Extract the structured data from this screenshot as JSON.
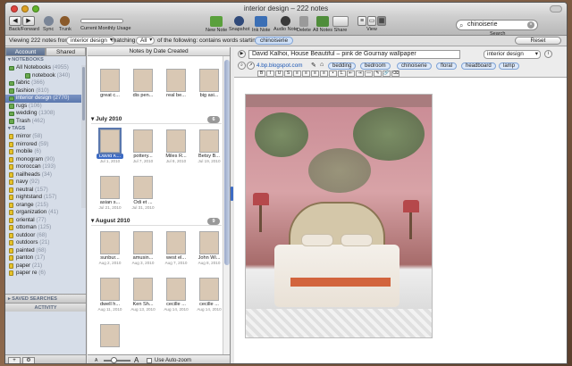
{
  "window": {
    "title": "interior design – 222 notes"
  },
  "toolbar": {
    "back_forward": "Back/Forward",
    "sync": "Sync",
    "trunk": "Trunk",
    "usage": "Current Monthly Usage",
    "new_note": "New Note",
    "snapshot": "Snapshot",
    "ink_note": "Ink Note",
    "audio_note": "Audio Note",
    "delete": "Delete",
    "all_notes": "All Notes",
    "share": "Share",
    "view": "View",
    "search_label": "Search",
    "search_value": "chinoiserie"
  },
  "filter": {
    "viewing": "Viewing 222 notes from",
    "notebook": "interior design",
    "matching": "matching",
    "match_mode": "All",
    "rest": "of the following: contains words starting with",
    "token": "chinoiserie",
    "reset": "Reset"
  },
  "sidebar": {
    "tabs": [
      "Account",
      "Shared"
    ],
    "notebooks_head": "NOTEBOOKS",
    "notebooks": [
      {
        "name": "All Notebooks",
        "count": "(4955)"
      },
      {
        "name": "notebook",
        "count": "(340)"
      },
      {
        "name": "fabric",
        "count": "(366)"
      },
      {
        "name": "fashion",
        "count": "(810)"
      },
      {
        "name": "interior design",
        "count": "(2770)"
      },
      {
        "name": "rugs",
        "count": "(106)"
      },
      {
        "name": "wedding",
        "count": "(1308)"
      },
      {
        "name": "Trash",
        "count": "(462)"
      }
    ],
    "tags_head": "TAGS",
    "tags": [
      {
        "name": "mirror",
        "count": "(58)"
      },
      {
        "name": "mirrored",
        "count": "(59)"
      },
      {
        "name": "mobile",
        "count": "(6)"
      },
      {
        "name": "monogram",
        "count": "(90)"
      },
      {
        "name": "moroccan",
        "count": "(193)"
      },
      {
        "name": "nailheads",
        "count": "(34)"
      },
      {
        "name": "navy",
        "count": "(92)"
      },
      {
        "name": "neutral",
        "count": "(157)"
      },
      {
        "name": "nightstand",
        "count": "(157)"
      },
      {
        "name": "orange",
        "count": "(215)"
      },
      {
        "name": "organization",
        "count": "(41)"
      },
      {
        "name": "oriental",
        "count": "(77)"
      },
      {
        "name": "ottoman",
        "count": "(125)"
      },
      {
        "name": "outdoor",
        "count": "(68)"
      },
      {
        "name": "outdoors",
        "count": "(21)"
      },
      {
        "name": "painted",
        "count": "(68)"
      },
      {
        "name": "panton",
        "count": "(17)"
      },
      {
        "name": "paper",
        "count": "(21)"
      },
      {
        "name": "paper re",
        "count": "(6)"
      }
    ],
    "saved_searches": "SAVED SEARCHES",
    "activity": "ACTIVITY"
  },
  "notelist": {
    "header": "Notes by Date Created",
    "top_row": [
      {
        "cap": "",
        "date": ""
      },
      {
        "cap": "great c...",
        "date": ""
      },
      {
        "cap": "dis pen...",
        "date": ""
      },
      {
        "cap": "real be...",
        "date": ""
      },
      {
        "cap": "big asi...",
        "date": ""
      }
    ],
    "sections": [
      {
        "title": "July 2010",
        "count": "6",
        "rows": [
          [
            {
              "cap": "David K...",
              "date": "Jul 1, 2010",
              "selected": true
            },
            {
              "cap": "pottery...",
              "date": "Jul 7, 2010"
            },
            {
              "cap": "Miles R...",
              "date": "Jul 8, 2010"
            },
            {
              "cap": "Betsy B...",
              "date": "Jul 19, 2010"
            }
          ],
          [
            {
              "cap": "asian s...",
              "date": "Jul 21, 2010"
            },
            {
              "cap": "Odi et ...",
              "date": "Jul 31, 2010"
            }
          ]
        ]
      },
      {
        "title": "August 2010",
        "count": "9",
        "rows": [
          [
            {
              "cap": "sunbur...",
              "date": "Aug 2, 2010"
            },
            {
              "cap": "amusin...",
              "date": "Aug 3, 2010"
            },
            {
              "cap": "west el...",
              "date": "Aug 7, 2010"
            },
            {
              "cap": "John Wi...",
              "date": "Aug 8, 2010"
            }
          ],
          [
            {
              "cap": "dwell h...",
              "date": "Aug 11, 2010"
            },
            {
              "cap": "Ken Sh...",
              "date": "Aug 13, 2010"
            },
            {
              "cap": "cecille ...",
              "date": "Aug 14, 2010"
            },
            {
              "cap": "cecille ...",
              "date": "Aug 14, 2010"
            }
          ],
          [
            {
              "cap": "",
              "date": ""
            }
          ]
        ]
      }
    ],
    "zoom_small": "A",
    "zoom_large": "A",
    "autozoom": "Use Auto-zoom"
  },
  "editor": {
    "title": "David Kalhoi, House Beautiful – pink de Gournay wallpaper",
    "notebook": "interior design",
    "url": "4.bp.blogspot.com",
    "tags": [
      "bedding",
      "bedroom",
      "chinoiserie",
      "floral",
      "headboard",
      "lamp"
    ]
  },
  "colors": {
    "accent": "#5a77ad",
    "tag": "#dde8f8"
  }
}
